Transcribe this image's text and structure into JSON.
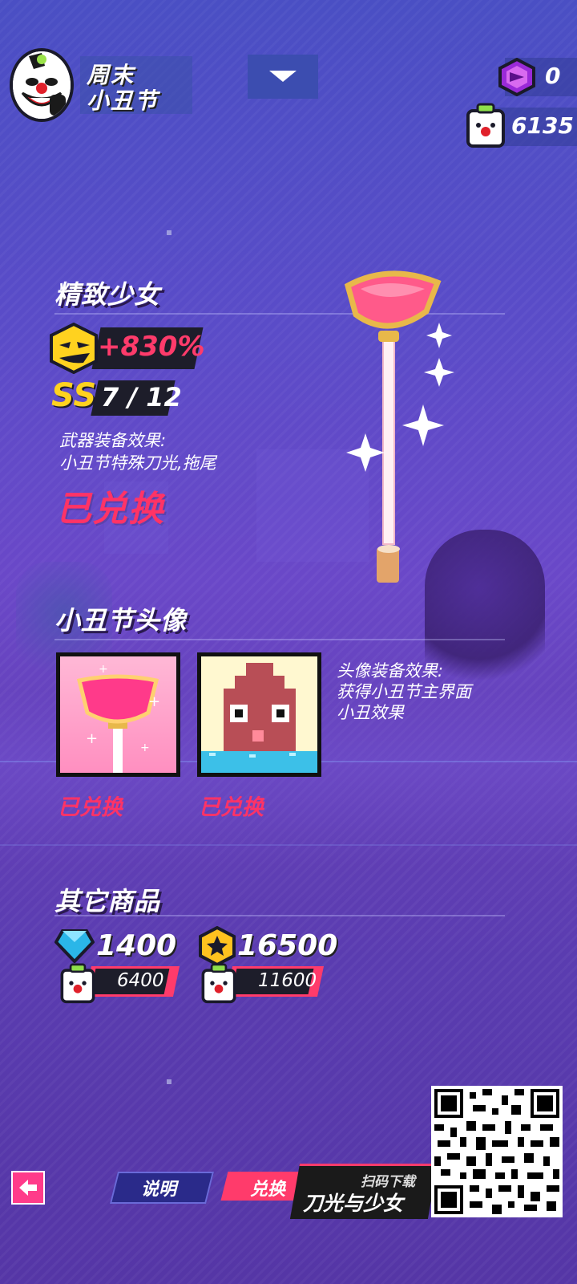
{
  "header": {
    "title_line1": "周末",
    "title_line2": "小丑节",
    "avatar_icon": "clown-avatar-icon",
    "dropdown_icon": "chevron-down-icon"
  },
  "currencies": {
    "gem_value": "0",
    "gem_icon": "purple-gem-icon",
    "token_value": "6135",
    "token_icon": "clown-token-icon"
  },
  "weapon": {
    "name": "精致少女",
    "bonus": "+830%",
    "grade": "SS",
    "count": "7 / 12",
    "effect_title": "武器装备效果:",
    "effect_desc": "小丑节特殊刀光,拖尾",
    "status": "已兑换"
  },
  "avatars": {
    "title": "小丑节头像",
    "items": [
      {
        "status": "已兑换",
        "icon": "plunger-avatar-icon"
      },
      {
        "status": "已兑换",
        "icon": "pixel-blob-avatar-icon"
      }
    ],
    "effect_title": "头像装备效果:",
    "effect_line1": "获得小丑节主界面",
    "effect_line2": "小丑效果"
  },
  "other": {
    "title": "其它商品",
    "items": [
      {
        "amount": "1400",
        "icon": "blue-diamond-icon",
        "price": "6400"
      },
      {
        "amount": "16500",
        "icon": "gold-coin-icon",
        "price": "11600"
      }
    ]
  },
  "bottom": {
    "tab_info": "说明",
    "tab_exchange": "兑换",
    "promo_small": "扫码下载",
    "promo_big": "刀光与少女"
  },
  "colors": {
    "accent": "#ff3366",
    "gold": "#ffd21f",
    "dark": "#1d1d2a"
  }
}
